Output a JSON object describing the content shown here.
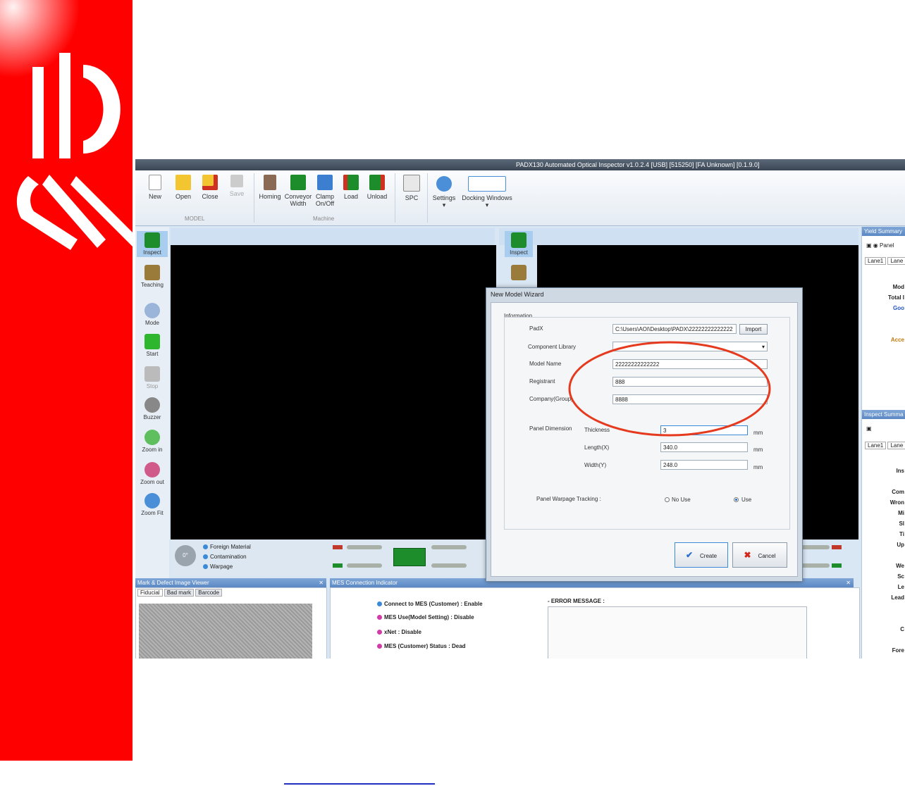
{
  "window": {
    "title": "PADX130 Automated Optical Inspector  v1.0.2.4  [USB] [515250] [FA Unknown] [0.1.9.0]"
  },
  "ribbon": {
    "model_buttons": [
      "New",
      "Open",
      "Close",
      "Save"
    ],
    "model_group": "MODEL",
    "machine_buttons": [
      {
        "line1": "Homing",
        "line2": ""
      },
      {
        "line1": "Conveyor",
        "line2": "Width"
      },
      {
        "line1": "Clamp",
        "line2": "On/Off"
      },
      {
        "line1": "Load",
        "line2": ""
      },
      {
        "line1": "Unload",
        "line2": ""
      }
    ],
    "machine_group": "Machine",
    "other_buttons": [
      "SPC",
      "Settings",
      "Docking Windows"
    ]
  },
  "left_tools": [
    "Inspect",
    "Teaching",
    "Mode",
    "Start",
    "Stop",
    "Buzzer",
    "Zoom in",
    "Zoom out",
    "Zoom Fit"
  ],
  "second_view_tool": "Inspect",
  "conveyor": {
    "angle": "0°",
    "legend": [
      "Foreign Material",
      "Contamination",
      "Warpage"
    ]
  },
  "defect_viewer": {
    "title": "Mark & Defect Image Viewer",
    "tabs": [
      "Fiducial",
      "Bad mark",
      "Barcode"
    ]
  },
  "mes": {
    "title": "MES Connection Indicator",
    "items": [
      "Connect to MES (Customer) : Enable",
      "MES Use(Model Setting) : Disable",
      "xNet : Disable",
      "MES (Customer) Status : Dead"
    ],
    "error_label": "- ERROR MESSAGE :"
  },
  "dialog": {
    "title": "New Model Wizard",
    "section": "Information",
    "padx_label": "PadX",
    "padx_value": "C:\\Users\\AOI\\Desktop\\PADX\\22222222222222",
    "import_label": "Import",
    "component_library_label": "Component Library",
    "component_library_value": "",
    "model_name_label": "Model Name",
    "model_name_value": "22222222222222",
    "registrant_label": "Registrant",
    "registrant_value": "888",
    "company_label": "Company(Group)",
    "company_value": "8888",
    "panel_dimension_label": "Panel Dimension",
    "thickness_label": "Thickness",
    "thickness_value": "3",
    "length_label": "Length(X)",
    "length_value": "340.0",
    "width_label": "Width(Y)",
    "width_value": "248.0",
    "unit": "mm",
    "warpage_label": "Panel Warpage Tracking :",
    "no_use_label": "No Use",
    "use_label": "Use",
    "create_label": "Create",
    "cancel_label": "Cancel"
  },
  "yield_summary": {
    "title": "Yield Summary",
    "panel_label": "Panel",
    "tabs": [
      "Lane1",
      "Lane"
    ],
    "rows": [
      "Mod",
      "Total I",
      "Goo",
      "",
      "Acce",
      ""
    ]
  },
  "inspect_summary": {
    "title": "Inspect Summa",
    "tabs": [
      "Lane1",
      "Lane"
    ],
    "rows": [
      "Ins",
      "",
      "Com",
      "Wron",
      "Mi",
      "Sl",
      "Ti",
      "Up",
      "",
      "We",
      "Sc",
      "Le",
      "Lead",
      "",
      "C",
      "Fore"
    ]
  }
}
